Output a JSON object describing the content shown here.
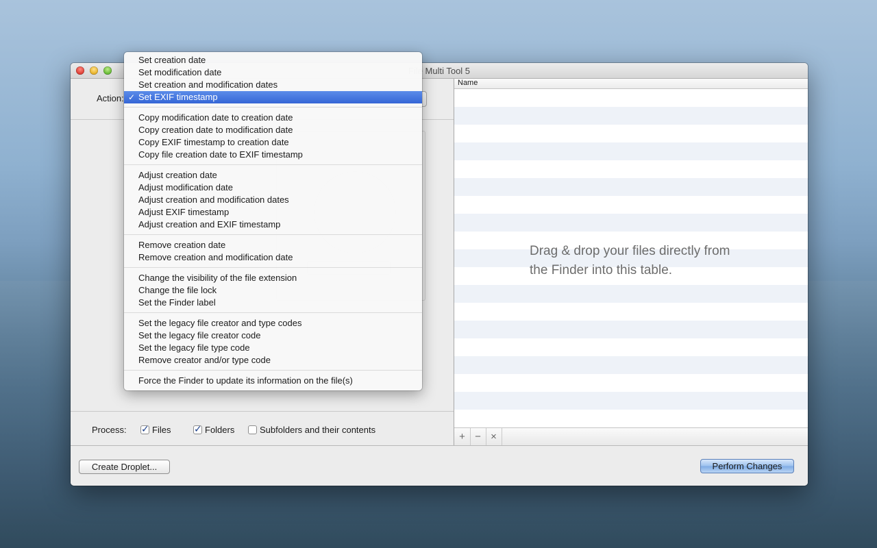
{
  "window": {
    "title": "File Multi Tool 5"
  },
  "left": {
    "action_label": "Action:",
    "process_label": "Process:",
    "process_options": [
      {
        "label": "Files",
        "checked": true
      },
      {
        "label": "Folders",
        "checked": true
      },
      {
        "label": "Subfolders and their contents",
        "checked": false
      }
    ]
  },
  "table": {
    "column_name": "Name",
    "drop_message": "Drag & drop your files directly from the Finder into this table.",
    "add_icon": "+",
    "remove_icon": "−",
    "clear_icon": "×"
  },
  "footer": {
    "create_droplet_label": "Create Droplet...",
    "perform_changes_label": "Perform Changes"
  },
  "menu": {
    "groups": [
      [
        "Set creation date",
        "Set modification date",
        "Set creation and modification dates",
        "Set EXIF timestamp"
      ],
      [
        "Copy modification date to creation date",
        "Copy creation date to modification date",
        "Copy EXIF timestamp to creation date",
        "Copy file creation date to EXIF timestamp"
      ],
      [
        "Adjust creation date",
        "Adjust modification date",
        "Adjust creation and modification dates",
        "Adjust EXIF timestamp",
        "Adjust creation and EXIF timestamp"
      ],
      [
        "Remove creation date",
        "Remove creation and modification date"
      ],
      [
        "Change the visibility of the file extension",
        "Change the file lock",
        "Set the Finder label"
      ],
      [
        "Set the legacy file creator and type codes",
        "Set the legacy file creator code",
        "Set the legacy file type code",
        "Remove creator and/or type code"
      ],
      [
        "Force the Finder to update its information on the file(s)"
      ]
    ],
    "selected": "Set EXIF timestamp",
    "check_glyph": "✓"
  },
  "colors": {
    "accent": "#3566d6",
    "stripe": "#eef2f8"
  }
}
